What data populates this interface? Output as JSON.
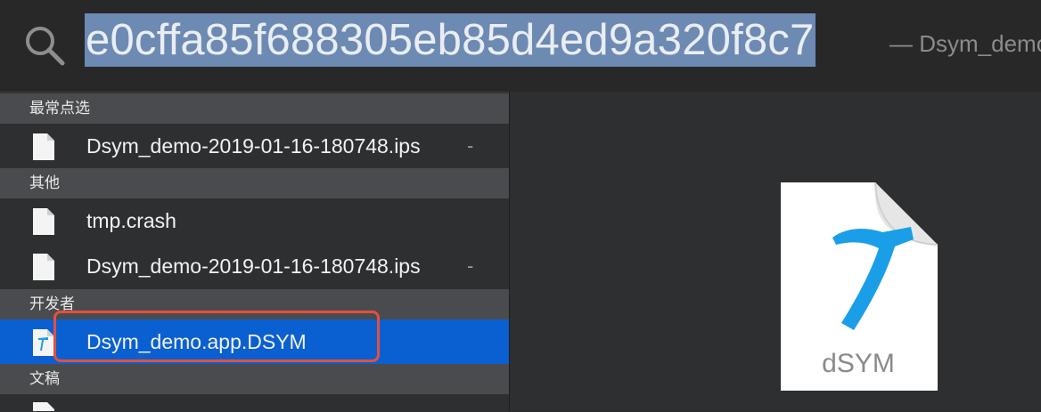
{
  "search": {
    "query": "e0cffa85f688305eb85d4ed9a320f8c7",
    "hint": "— Dsym_demo"
  },
  "sections": [
    {
      "title": "最常点选"
    },
    {
      "title": "其他"
    },
    {
      "title": "开发者"
    },
    {
      "title": "文稿"
    }
  ],
  "results": {
    "frequent_0": {
      "label": "Dsym_demo-2019-01-16-180748.ips",
      "suffix": "-"
    },
    "other_0": {
      "label": "tmp.crash"
    },
    "other_1": {
      "label": "Dsym_demo-2019-01-16-180748.ips",
      "suffix": "-"
    },
    "developer_0": {
      "label": "Dsym_demo.app.DSYM"
    }
  },
  "preview": {
    "icon_label": "dSYM"
  },
  "colors": {
    "selection": "#0a60d0",
    "query_highlight": "#6d8ab3",
    "annotation": "#e5503a",
    "hammer": "#1a9ee8"
  }
}
